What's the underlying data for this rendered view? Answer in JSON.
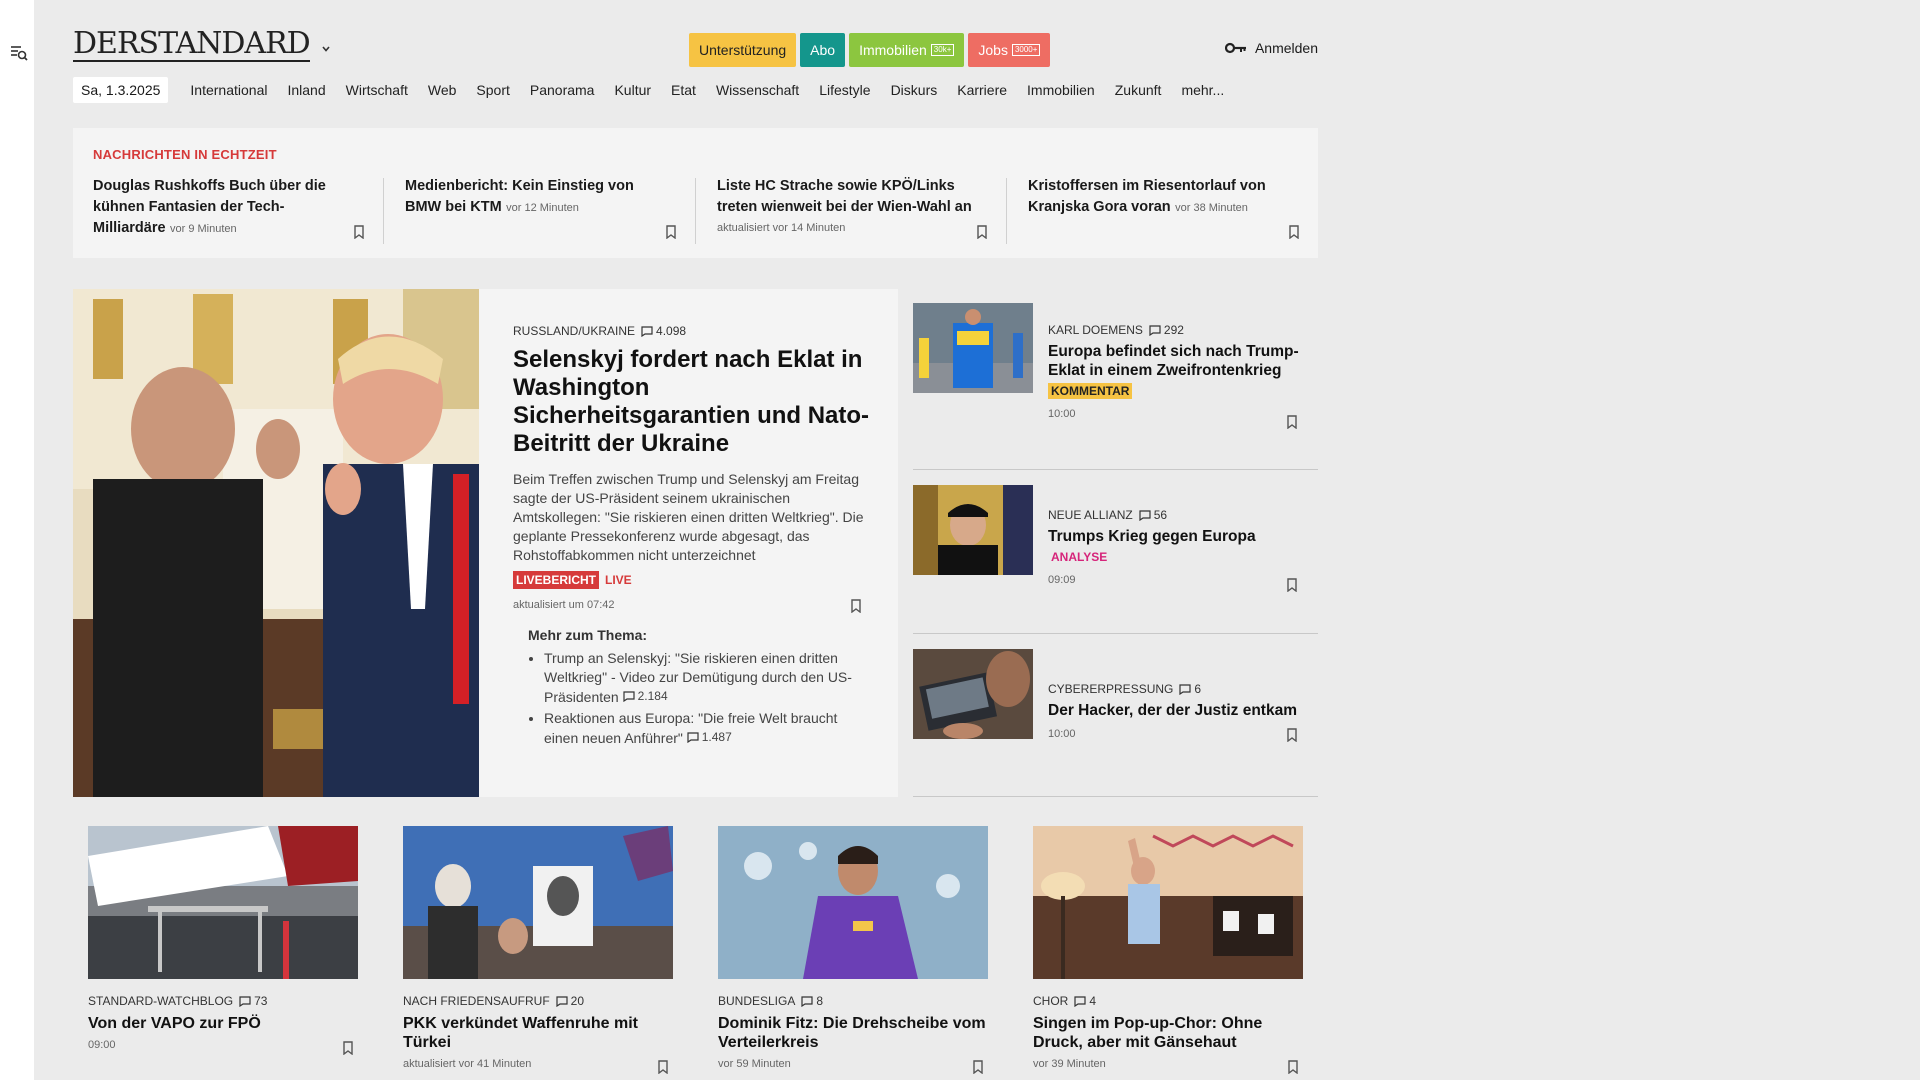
{
  "brand": {
    "logo": "DERSTANDARD"
  },
  "header": {
    "pills": [
      {
        "label": "Unterstützung",
        "tag": "",
        "bg": "#f6c343",
        "fg": "#222"
      },
      {
        "label": "Abo",
        "tag": "",
        "bg": "#14968c",
        "fg": "#fff"
      },
      {
        "label": "Immobilien",
        "tag": "30k+",
        "bg": "#8cc63f",
        "fg": "#fff"
      },
      {
        "label": "Jobs",
        "tag": "3000+",
        "bg": "#ee6d63",
        "fg": "#fff"
      }
    ],
    "login": "Anmelden"
  },
  "nav": {
    "date": "Sa, 1.3.2025",
    "items": [
      "International",
      "Inland",
      "Wirtschaft",
      "Web",
      "Sport",
      "Panorama",
      "Kultur",
      "Etat",
      "Wissenschaft",
      "Lifestyle",
      "Diskurs",
      "Karriere",
      "Immobilien",
      "Zukunft",
      "mehr..."
    ]
  },
  "ticker": {
    "heading": "NACHRICHTEN IN ECHTZEIT",
    "items": [
      {
        "title": "Douglas Rushkoffs Buch über die kühnen Fantasien der Tech-Milliardäre",
        "ago": "vor 9 Minuten"
      },
      {
        "title": "Medienbericht: Kein Einstieg von BMW bei KTM",
        "ago": "vor 12 Minuten"
      },
      {
        "title": "Liste HC Strache sowie KPÖ/Links treten wienweit bei der Wien-Wahl an",
        "ago": "aktualisiert vor 14 Minuten"
      },
      {
        "title": "Kristoffersen im Riesentorlauf von Kranjska Gora voran",
        "ago": "vor 38 Minuten"
      }
    ]
  },
  "lead": {
    "kicker": "RUSSLAND/UKRAINE",
    "comments": "4.098",
    "title": "Selenskyj fordert nach Eklat in Washington Sicherheitsgarantien und Nato-Beitritt der Ukraine",
    "teaser": "Beim Treffen zwischen Trump und Selenskyj am Freitag sagte der US-Präsident seinem ukrainischen Amtskollegen: \"Sie riskieren einen dritten Weltkrieg\". Die geplante Pressekonferenz wurde abgesagt, das Rohstoffabkommen nicht unterzeichnet",
    "live_badge": "LIVEBERICHT",
    "live": "LIVE",
    "updated": "aktualisiert um 07:42",
    "more_heading": "Mehr zum Thema:",
    "more": [
      {
        "text": "Trump an Selenskyj: \"Sie riskieren einen dritten Weltkrieg\" - Video zur Demütigung durch den US-Präsidenten",
        "comments": "2.184"
      },
      {
        "text": "Reaktionen aus Europa: \"Die freie Welt braucht einen neuen Anführer\"",
        "comments": "1.487"
      }
    ]
  },
  "side": [
    {
      "kicker": "KARL DOEMENS",
      "comments": "292",
      "title": "Europa befindet sich nach Trump-Eklat in einem Zweifrontenkrieg",
      "badge": "KOMMENTAR",
      "badge_bg": "#f6c343",
      "badge_fg": "#222",
      "time": "10:00"
    },
    {
      "kicker": "NEUE ALLIANZ",
      "comments": "56",
      "title": "Trumps Krieg gegen Europa",
      "badge": "ANALYSE",
      "badge_bg": "transparent",
      "badge_fg": "#d6247a",
      "time": "09:09"
    },
    {
      "kicker": "CYBERERPRESSUNG",
      "comments": "6",
      "title": "Der Hacker, der der Justiz entkam",
      "badge": "",
      "badge_bg": "transparent",
      "badge_fg": "#222",
      "time": "10:00"
    }
  ],
  "bottom": [
    {
      "kicker": "STANDARD-WATCHBLOG",
      "comments": "73",
      "title": "Von der VAPO zur FPÖ",
      "time": "09:00"
    },
    {
      "kicker": "NACH FRIEDENSAUFRUF",
      "comments": "20",
      "title": "PKK verkündet Waffenruhe mit Türkei",
      "time": "aktualisiert vor 41 Minuten"
    },
    {
      "kicker": "BUNDESLIGA",
      "comments": "8",
      "title": "Dominik Fitz: Die Drehscheibe vom Verteilerkreis",
      "time": "vor 59 Minuten"
    },
    {
      "kicker": "CHOR",
      "comments": "4",
      "title": "Singen im Pop-up-Chor: Ohne Druck, aber mit Gänsehaut",
      "time": "vor 39 Minuten"
    }
  ],
  "colors": {
    "accent_red": "#d63a3a",
    "page_bg": "#ebebeb",
    "card_bg": "#f4f4f4"
  }
}
